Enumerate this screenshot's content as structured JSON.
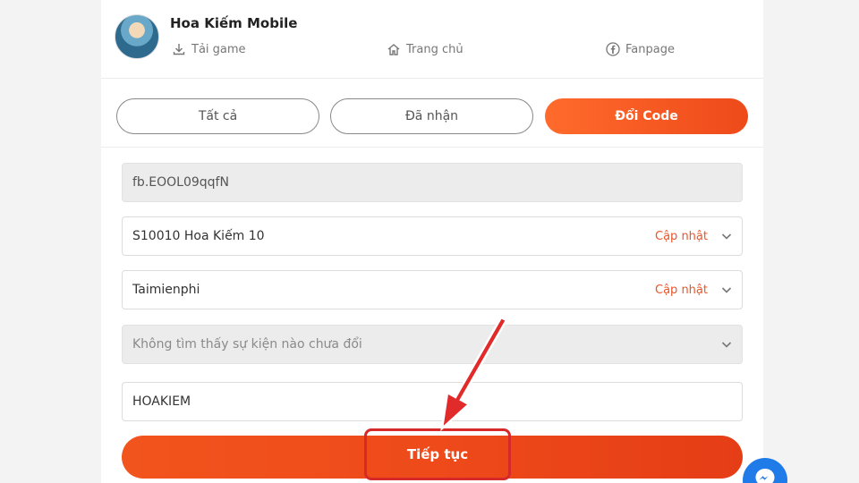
{
  "header": {
    "app_title": "Hoa Kiếm Mobile",
    "nav": [
      {
        "label": "Tải game",
        "icon": "download-icon"
      },
      {
        "label": "Trang chủ",
        "icon": "home-icon"
      },
      {
        "label": "Fanpage",
        "icon": "facebook-icon"
      }
    ]
  },
  "tabs": [
    {
      "label": "Tất cả",
      "active": false
    },
    {
      "label": "Đã nhận",
      "active": false
    },
    {
      "label": "Đổi Code",
      "active": true
    }
  ],
  "form": {
    "account": "fb.EOOL09qqfN",
    "server": {
      "value": "S10010 Hoa Kiếm 10",
      "action": "Cập nhật"
    },
    "character": {
      "value": "Taimienphi",
      "action": "Cập nhật"
    },
    "event": {
      "value": "Không tìm thấy sự kiện nào chưa đổi"
    },
    "code": "HOAKIEM",
    "submit_label": "Tiếp tục"
  },
  "colors": {
    "accent": "#ee4a1a",
    "update_text": "#e8562b",
    "highlight": "#d62a2a",
    "messenger": "#1f7be8"
  }
}
